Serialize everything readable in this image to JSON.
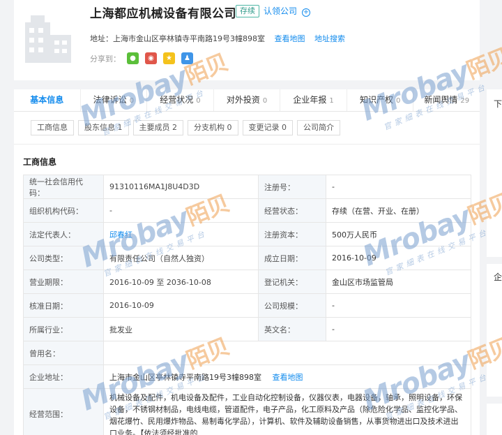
{
  "company": {
    "name": "上海都应机械设备有限公司",
    "status": "存续",
    "claim_label": "认领公司",
    "address_label": "地址：",
    "address": "上海市金山区亭林镇寺平南路19号3幢898室",
    "view_map": "查看地图",
    "address_search": "地址搜索",
    "share_label": "分享到："
  },
  "tabs": [
    {
      "label": "基本信息",
      "count": ""
    },
    {
      "label": "法律诉讼",
      "count": "0"
    },
    {
      "label": "经营状况",
      "count": "0"
    },
    {
      "label": "对外投资",
      "count": "0"
    },
    {
      "label": "企业年报",
      "count": "1"
    },
    {
      "label": "知识产权",
      "count": "0"
    },
    {
      "label": "新闻舆情",
      "count": "29"
    }
  ],
  "subtabs": [
    {
      "label": "工商信息",
      "count": ""
    },
    {
      "label": "股东信息",
      "count": "1"
    },
    {
      "label": "主要成员",
      "count": "2"
    },
    {
      "label": "分支机构",
      "count": "0"
    },
    {
      "label": "变更记录",
      "count": "0"
    },
    {
      "label": "公司简介",
      "count": ""
    }
  ],
  "section_title": "工商信息",
  "rows": [
    {
      "l1": "统一社会信用代码：",
      "v1": "91310116MA1J8U4D3D",
      "l2": "注册号：",
      "v2": "-"
    },
    {
      "l1": "组织机构代码：",
      "v1": "-",
      "l2": "经营状态：",
      "v2": "存续（在营、开业、在册）"
    },
    {
      "l1": "法定代表人：",
      "v1": "邱春红",
      "l2": "注册资本：",
      "v2": "500万人民币"
    },
    {
      "l1": "公司类型：",
      "v1": "有限责任公司（自然人独资）",
      "l2": "成立日期：",
      "v2": "2016-10-09"
    },
    {
      "l1": "营业期限：",
      "v1": "2016-10-09 至 2036-10-08",
      "l2": "登记机关：",
      "v2": "金山区市场监管局"
    },
    {
      "l1": "核准日期：",
      "v1": "2016-10-09",
      "l2": "公司规模：",
      "v2": "-"
    },
    {
      "l1": "所属行业：",
      "v1": "批发业",
      "l2": "英文名：",
      "v2": "-"
    }
  ],
  "former_name_label": "曾用名：",
  "address_row": {
    "label": "企业地址：",
    "value": "上海市金山区亭林镇寺平南路19号3幢898室",
    "link": "查看地图"
  },
  "scope": {
    "label": "经营范围：",
    "value": "机械设备及配件，机电设备及配件，工业自动化控制设备，仪器仪表，电器设备，轴承，照明设备，环保设备，不锈钢材制品，电线电缆，管道配件，电子产品，化工原料及产品（除危险化学品、监控化学品、烟花爆竹、民用爆炸物品、易制毒化学品），计算机、软件及辅助设备销售，从事货物进出口及技术进出口业务。【依法须经批准的"
  },
  "side": {
    "text1": "下",
    "text2": "企"
  },
  "watermark": {
    "brand": "Mrobay",
    "brand_cn": "陌贝",
    "slogan": "官家細表在线交易平台"
  },
  "colors": {
    "accent": "#128bed",
    "status": "#2e9a89"
  }
}
